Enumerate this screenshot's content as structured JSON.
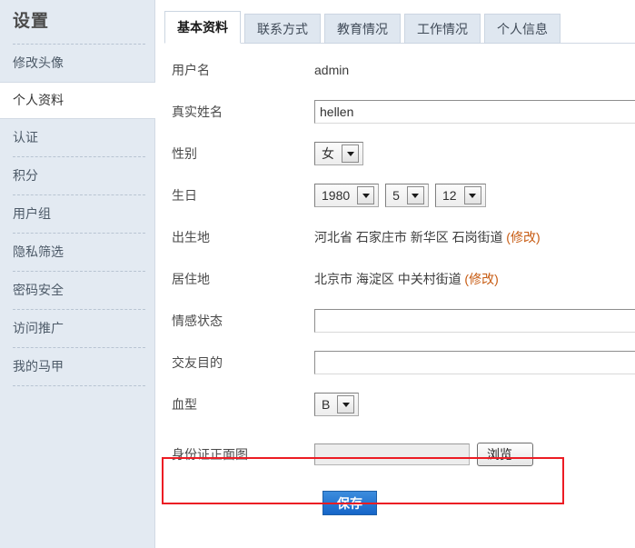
{
  "sidebar": {
    "title": "设置",
    "items": [
      {
        "label": "修改头像",
        "active": false
      },
      {
        "label": "个人资料",
        "active": true
      },
      {
        "label": "认证",
        "active": false
      },
      {
        "label": "积分",
        "active": false
      },
      {
        "label": "用户组",
        "active": false
      },
      {
        "label": "隐私筛选",
        "active": false
      },
      {
        "label": "密码安全",
        "active": false
      },
      {
        "label": "访问推广",
        "active": false
      },
      {
        "label": "我的马甲",
        "active": false
      }
    ]
  },
  "tabs": [
    {
      "label": "基本资料",
      "active": true
    },
    {
      "label": "联系方式",
      "active": false
    },
    {
      "label": "教育情况",
      "active": false
    },
    {
      "label": "工作情况",
      "active": false
    },
    {
      "label": "个人信息",
      "active": false
    }
  ],
  "form": {
    "username": {
      "label": "用户名",
      "value": "admin"
    },
    "realname": {
      "label": "真实姓名",
      "value": "hellen",
      "placeholder": ""
    },
    "gender": {
      "label": "性别",
      "value": "女"
    },
    "birthday": {
      "label": "生日",
      "year": "1980",
      "month": "5",
      "day": "12"
    },
    "birthplace": {
      "label": "出生地",
      "value": "河北省 石家庄市 新华区 石岗街道",
      "edit_link": "(修改)"
    },
    "residence": {
      "label": "居住地",
      "value": "北京市 海淀区 中关村街道",
      "edit_link": "(修改)"
    },
    "emotion": {
      "label": "情感状态",
      "value": "",
      "placeholder": ""
    },
    "purpose": {
      "label": "交友目的",
      "value": "",
      "placeholder": ""
    },
    "bloodtype": {
      "label": "血型",
      "value": "B"
    },
    "idcard_front": {
      "label": "身份证正面图",
      "value": "",
      "browse_label": "浏览..."
    }
  },
  "actions": {
    "save_label": "保存"
  },
  "colors": {
    "sidebar_bg": "#e3eaf2",
    "accent_blue": "#1565c8",
    "link_orange": "#c75b12",
    "highlight_red": "#ec1c24"
  }
}
